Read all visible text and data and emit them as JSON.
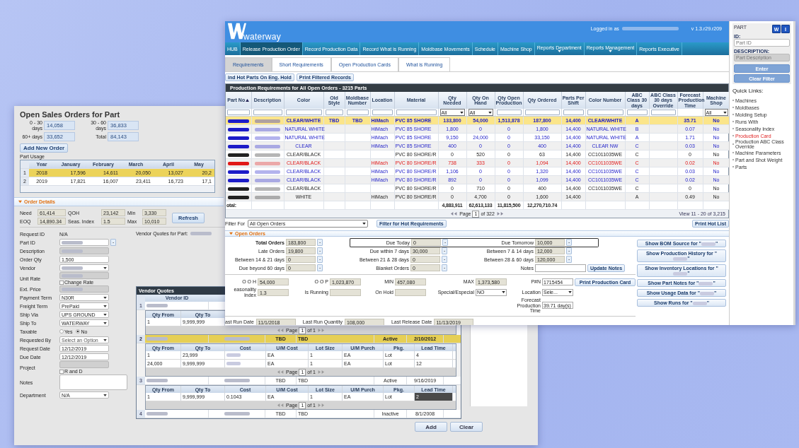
{
  "main_window": {
    "logo": "waterway",
    "logged_in": "Logged in as",
    "version": "v 1.3.r29.r209",
    "nav": [
      {
        "label": "HUB",
        "selected": false,
        "dropdown": false
      },
      {
        "label": "Release Production Order",
        "selected": true,
        "dropdown": false
      },
      {
        "label": "Record Production Data",
        "selected": false,
        "dropdown": false
      },
      {
        "label": "Record What is Running",
        "selected": false,
        "dropdown": false
      },
      {
        "label": "Moldbase Movements",
        "selected": false,
        "dropdown": false
      },
      {
        "label": "Schedule",
        "selected": false,
        "dropdown": false
      },
      {
        "label": "Machine Shop",
        "selected": false,
        "dropdown": false
      },
      {
        "label": "Reports Department",
        "selected": false,
        "dropdown": true
      },
      {
        "label": "Reports Management",
        "selected": false,
        "dropdown": true
      },
      {
        "label": "Reports Executive",
        "selected": false,
        "dropdown": false
      }
    ],
    "tabs": [
      {
        "label": "Requirements",
        "selected": true
      },
      {
        "label": "Short Requirements",
        "selected": false
      },
      {
        "label": "Open Production Cards",
        "selected": false
      },
      {
        "label": "What is Running",
        "selected": false
      }
    ],
    "actions": [
      "ind Hot Parts On Eng. Hold",
      "Print Filtered Records"
    ],
    "grid": {
      "title": "Production Requirements for All Open Orders - 3215 Parts",
      "columns": [
        {
          "label": "Part No",
          "sorted": true,
          "kind": "text"
        },
        {
          "label": "Description",
          "sorted": false,
          "kind": "text"
        },
        {
          "label": "Color",
          "sorted": false,
          "kind": "text"
        },
        {
          "label": "Old Style",
          "sorted": false,
          "kind": "text"
        },
        {
          "label": "Moldbase Number",
          "sorted": false,
          "kind": "text"
        },
        {
          "label": "Location",
          "sorted": false,
          "kind": "text"
        },
        {
          "label": "Material",
          "sorted": false,
          "kind": "text"
        },
        {
          "label": "Qty Needed",
          "sorted": false,
          "kind": "select",
          "filter_value": "All"
        },
        {
          "label": "Qty On Hand",
          "sorted": false,
          "kind": "select",
          "filter_value": "All"
        },
        {
          "label": "Qty Open Production",
          "sorted": false,
          "kind": "text"
        },
        {
          "label": "Qty Ordered",
          "sorted": false,
          "kind": "text"
        },
        {
          "label": "Parts Per Shift",
          "sorted": false,
          "kind": "text"
        },
        {
          "label": "Color Number",
          "sorted": false,
          "kind": "text"
        },
        {
          "label": "ABC Class 30 days",
          "sorted": false,
          "kind": "text"
        },
        {
          "label": "ABC Class 30 days Override",
          "sorted": false,
          "kind": "text"
        },
        {
          "label": "Forecast Production Time",
          "sorted": false,
          "kind": "none"
        },
        {
          "label": "Machine Shop",
          "sorted": false,
          "kind": "select",
          "filter_value": "All"
        }
      ],
      "rows": [
        {
          "selected": true,
          "color": "#1c1cc8",
          "cells": [
            "",
            "",
            "CLEAR/WHITE",
            "TBD",
            "TBD",
            "HiMach",
            "PVC 85 SHORE",
            "133,800",
            "54,000",
            "1,513,878",
            "187,800",
            "14,400",
            "CLEAR/WHITE",
            "A",
            null,
            "35.71",
            "No"
          ]
        },
        {
          "selected": false,
          "color": "#1c1cc8",
          "cells": [
            "",
            "",
            "NATURAL WHITE",
            null,
            null,
            "HiMach",
            "PVC 85 SHORE",
            "1,800",
            "0",
            "0",
            "1,800",
            "14,400",
            "NATURAL WHITE",
            "B",
            null,
            "0.07",
            "No"
          ]
        },
        {
          "selected": false,
          "color": "#1c1cc8",
          "cells": [
            "",
            "",
            "NATURAL WHITE",
            null,
            null,
            "HiMach",
            "PVC 85 SHORE",
            "9,150",
            "24,000",
            "0",
            "33,150",
            "14,400",
            "NATURAL WHITE",
            "A",
            null,
            "1.71",
            "No"
          ]
        },
        {
          "selected": false,
          "color": "#1c1cc8",
          "cells": [
            "",
            "",
            "CLEAR",
            null,
            null,
            "HiMach",
            "PVC 85 SHORE",
            "400",
            "0",
            "0",
            "400",
            "14,400",
            "CLEAR NW",
            "C",
            null,
            "0.03",
            "No"
          ]
        },
        {
          "selected": false,
          "color": "#222222",
          "cells": [
            "",
            "",
            "CLEAR/BLACK",
            null,
            null,
            null,
            "PVC 80 SHORE/R",
            "0",
            "520",
            "0",
            "63",
            "14,400",
            "CC1011035WE",
            "C",
            null,
            "0",
            "No"
          ]
        },
        {
          "selected": false,
          "color": "#e01818",
          "cells": [
            "",
            "",
            "CLEAR/BLACK",
            null,
            null,
            "HiMach",
            "PVC 80 SHORE/R",
            "738",
            "333",
            "0",
            "1,094",
            "14,400",
            "CC1011035WE",
            "C",
            null,
            "0.02",
            "No"
          ]
        },
        {
          "selected": false,
          "color": "#1c1cc8",
          "cells": [
            "",
            "",
            "CLEAR/BLACK",
            null,
            null,
            "HiMach",
            "PVC 80 SHORE/R",
            "1,106",
            "0",
            "0",
            "1,320",
            "14,400",
            "CC1011035WE",
            "C",
            null,
            "0.03",
            "No"
          ]
        },
        {
          "selected": false,
          "color": "#1c1cc8",
          "cells": [
            "",
            "",
            "CLEAR/BLACK",
            null,
            null,
            "HiMach",
            "PVC 80 SHORE/R",
            "892",
            "0",
            "0",
            "1,099",
            "14,400",
            "CC1011035WE",
            "C",
            null,
            "0.02",
            "No"
          ]
        },
        {
          "selected": false,
          "color": "#222222",
          "cells": [
            "",
            "",
            "CLEAR/BLACK",
            null,
            null,
            null,
            "PVC 80 SHORE/R",
            "0",
            "710",
            "0",
            "400",
            "14,400",
            "CC1011035WE",
            "C",
            null,
            "0",
            "No"
          ]
        },
        {
          "selected": false,
          "color": "#222222",
          "cells": [
            "",
            "",
            "WHITE",
            null,
            null,
            "HiMach",
            "PVC 80 SHORE/R",
            "0",
            "4,700",
            "0",
            "1,600",
            "14,400",
            null,
            "A",
            null,
            "0.49",
            "No"
          ]
        }
      ],
      "totals": {
        "label": "otal:",
        "values": [
          "4,883,911",
          "62,613,133",
          "11,815,500",
          "12,270,710.74"
        ]
      },
      "pager": {
        "label": "Page",
        "page": "1",
        "of": "of 322",
        "view": "View 11 - 20 of 3,215"
      }
    },
    "filter": {
      "label": "Filter For",
      "value": "All Open Orders",
      "button": "Filter for Hot Requirements",
      "print": "Print Hot List"
    },
    "open_orders": {
      "title": "Open Orders",
      "expanded": true,
      "counts": [
        [
          {
            "kind": "count",
            "label": "Total Orders",
            "value": "183,800",
            "button": "-"
          },
          {
            "kind": "count",
            "label": "Due Today",
            "value": "0",
            "button": "-"
          },
          {
            "kind": "count",
            "label": "Due Tomorrow",
            "value": "10,000",
            "button": "-"
          }
        ],
        [
          {
            "kind": "count",
            "label": "Late Orders",
            "value": "19,800",
            "button": "-"
          },
          {
            "kind": "count",
            "label": "Due within 7 days",
            "value": "30,000",
            "button": "-"
          },
          {
            "kind": "count",
            "label": "Between 7 & 14 days",
            "value": "12,000",
            "button": "-"
          }
        ],
        [
          {
            "kind": "count",
            "label": "Between 14 & 21 days",
            "value": "0",
            "button": "-"
          },
          {
            "kind": "count",
            "label": "Between 21 & 28 days",
            "value": "0",
            "button": "-"
          },
          {
            "kind": "count",
            "label": "Between 28 & 60 days",
            "value": "120,000",
            "button": "-"
          }
        ],
        [
          {
            "kind": "count",
            "label": "Due beyond 60 days",
            "value": "0",
            "button": "-"
          },
          {
            "kind": "count",
            "label": "Blanket Orders",
            "value": "0",
            "button": "-"
          },
          {
            "kind": "notes",
            "label": "Notes",
            "button": "Update Notes"
          }
        ]
      ],
      "stock": [
        [
          {
            "kind": "readonly",
            "label": "O O H",
            "value": "54,000"
          },
          {
            "kind": "readonly",
            "label": "O O P",
            "value": "1,023,870"
          },
          {
            "kind": "readonly",
            "label": "MIN",
            "value": "457,080"
          },
          {
            "kind": "readonly",
            "label": "MAX",
            "value": "1,373,580"
          },
          {
            "kind": "input",
            "label": "P#N",
            "value": "1715454"
          }
        ],
        [
          {
            "kind": "readonly",
            "label": "easonality Index",
            "value": "1.3"
          },
          {
            "kind": "readonly",
            "label": "Is Running"
          },
          {
            "kind": "readonly",
            "label": "On Hold"
          },
          {
            "kind": "select",
            "label": "Special/Especial",
            "value": "NO"
          },
          {
            "kind": "select",
            "label": "Location",
            "value": "Sele..."
          }
        ],
        [
          {
            "kind": "input",
            "label": "Forecast Production Time",
            "value": "39.71 day(s)"
          }
        ]
      ],
      "print_button": "Print Production Card",
      "last_run": [
        {
          "label": "ast Run Date",
          "value": "11/1/2018"
        },
        {
          "label": "Last Run Quantity",
          "value": "108,000"
        },
        {
          "label": "Last Release Date",
          "value": "11/13/2019"
        }
      ],
      "side_buttons": [
        {
          "prefix": "Show BOM Source for \"",
          "suffix": "\""
        },
        {
          "prefix": "Show Production History for \"",
          "suffix": "\""
        },
        {
          "prefix": "Show Inventory Locations for \"",
          "suffix": "\""
        },
        {
          "prefix": "Show Part Notes for \"",
          "suffix": "\""
        },
        {
          "prefix": "Show Usage Data for \"",
          "suffix": "\""
        },
        {
          "prefix": "Show Runs for \"",
          "suffix": "\""
        }
      ]
    },
    "panel": {
      "title": "PART",
      "buttons": [
        "W",
        "I"
      ],
      "id_field": {
        "label": "ID:",
        "placeholder": "Part ID"
      },
      "desc_field": {
        "label": "DESCRIPTION:",
        "placeholder": "Part Description"
      },
      "enter": "Enter",
      "clear": "Clear Filter",
      "quick_title": "Quick Links:",
      "links": [
        {
          "label": "Machines",
          "selected": false
        },
        {
          "label": "Moldbases",
          "selected": false
        },
        {
          "label": "Molding Setup",
          "selected": false
        },
        {
          "label": "Runs With",
          "selected": false
        },
        {
          "label": "Seasonality Index",
          "selected": false
        },
        {
          "label": "Production Card",
          "selected": true
        },
        {
          "label": "Production ABC Class Override",
          "selected": false
        },
        {
          "label": "Machine Parameters",
          "selected": false
        },
        {
          "label": "Part and Shot Weight",
          "selected": false
        },
        {
          "label": "Parts",
          "selected": false
        }
      ]
    }
  },
  "sales_order_window": {
    "title": "Open Sales Orders for Part",
    "summary": [
      {
        "label": "0 - 30 days",
        "value": "14,058"
      },
      {
        "label": "30 - 60 days",
        "value": "36,833"
      },
      {
        "label": "60+ days",
        "value": "33,652"
      },
      {
        "label": "Total",
        "value": "84,143"
      }
    ],
    "add_button": "Add New Order",
    "usage": {
      "label": "Part Usage",
      "columns": [
        "Year",
        "January",
        "February",
        "March",
        "April",
        "May"
      ],
      "rows": [
        {
          "index": "1",
          "selected": true,
          "cells": [
            "2018",
            "17,596",
            "14,611",
            "20,050",
            "13,027",
            "20,2"
          ]
        },
        {
          "index": "2",
          "selected": false,
          "cells": [
            "2019",
            "17,821",
            "16,007",
            "23,411",
            "16,723",
            "17,1"
          ]
        }
      ]
    },
    "order_details": {
      "title": "Order Details",
      "expanded": true,
      "stats": [
        {
          "label": "Need",
          "value": "61,414"
        },
        {
          "label": "QOH",
          "value": "23,142"
        },
        {
          "label": "Min",
          "value": "3,330"
        },
        {
          "label": "EOQ",
          "value": "14,890.34"
        },
        {
          "label": "Seas. Index",
          "value": "1.5"
        },
        {
          "label": "Max",
          "value": "10,010"
        }
      ],
      "refresh": "Refresh"
    },
    "form": [
      {
        "label": "Request ID",
        "kind": "text",
        "value": "N/A"
      },
      {
        "label": "Part ID",
        "kind": "input",
        "blurred": true,
        "disabled": false,
        "button": "-"
      },
      {
        "label": "Description",
        "kind": "input",
        "blurred": true,
        "disabled": true
      },
      {
        "label": "Order Qty",
        "kind": "input",
        "disabled": false,
        "value": "1,500"
      },
      {
        "label": "Vendor",
        "kind": "select",
        "blurred": true
      },
      {
        "label": "Unit Rate",
        "kind": "input",
        "blurred": true,
        "disabled": true,
        "checkbox": {
          "label": "Change Rate",
          "checked": false
        }
      },
      {
        "label": "Ext. Price",
        "kind": "input",
        "blurred": true,
        "disabled": true
      },
      {
        "label": "Payment Term",
        "kind": "select",
        "value": "N30R"
      },
      {
        "label": "Freight Term",
        "kind": "select",
        "value": "PrePaid"
      },
      {
        "label": "Ship Via",
        "kind": "select",
        "value": "UPS GROUND"
      },
      {
        "label": "Ship To",
        "kind": "select",
        "value": "WATERWAY"
      },
      {
        "label": "Taxable",
        "kind": "radio",
        "options": [
          {
            "label": "Yes",
            "selected": false
          },
          {
            "label": "No",
            "selected": true
          }
        ]
      },
      {
        "label": "Requested By",
        "kind": "select",
        "placeholder": "Select an Option"
      },
      {
        "label": "Request Date",
        "kind": "input",
        "disabled": false,
        "value": "12/12/2019"
      },
      {
        "label": "Due Date",
        "kind": "input",
        "disabled": false,
        "value": "12/12/2019"
      },
      {
        "label": "Project",
        "kind": "input",
        "disabled": true,
        "checkbox": {
          "label": "R and D",
          "checked": false
        }
      },
      {
        "label": "Notes",
        "kind": "textarea"
      },
      {
        "label": "Department",
        "kind": "select",
        "value": "N/A"
      }
    ],
    "vendor_heading": "Vendor Quotes for Part:",
    "vendor_quotes": {
      "title": "Vendor Quotes",
      "column": "Vendor ID",
      "vendors": [
        {
          "index": "1",
          "selected": false,
          "sub_columns": [
            "Qty From",
            "Qty To"
          ],
          "quotes": [
            {
              "selected": false,
              "cells": [
                "1",
                "9,999,999"
              ]
            }
          ],
          "page_label": "Page",
          "page": "1",
          "of": "of 1"
        },
        {
          "index": "2",
          "selected": true,
          "cells": [
            "TBD",
            "TBD",
            "Active",
            "2/10/2012"
          ],
          "sub_columns": [
            "Qty From",
            "Qty To",
            "Cost",
            "U/M Cost",
            "Lot Size",
            "U/M Purch",
            "Pkg.",
            "Lead Time"
          ],
          "quotes": [
            {
              "selected": false,
              "cells": [
                "1",
                "23,999",
                null,
                "EA",
                "1",
                "EA",
                "Lot",
                "4"
              ]
            },
            {
              "selected": false,
              "cells": [
                "24,000",
                "9,999,999",
                null,
                "EA",
                "1",
                "EA",
                "Lot",
                "12"
              ]
            }
          ],
          "page_label": "Page",
          "page": "1",
          "of": "of 1"
        },
        {
          "index": "3",
          "selected": false,
          "cells": [
            "TBD",
            "TBD",
            "Active",
            "9/16/2019"
          ],
          "sub_columns": [
            "Qty From",
            "Qty To",
            "Cost",
            "U/M Cost",
            "Lot Size",
            "U/M Purch",
            "Pkg.",
            "Lead Time"
          ],
          "quotes": [
            {
              "selected": true,
              "cells": [
                "1",
                "9,999,999",
                "0.1043",
                "EA",
                "1",
                "EA",
                "Lot",
                "2"
              ]
            }
          ],
          "page_label": "Page",
          "page": "1",
          "of": "of 1"
        },
        {
          "index": "4",
          "selected": false,
          "cells": [
            "TBD",
            "TBD",
            "Inactive",
            "8/1/2008"
          ]
        }
      ]
    },
    "buttons": [
      "Add",
      "Clear"
    ]
  }
}
